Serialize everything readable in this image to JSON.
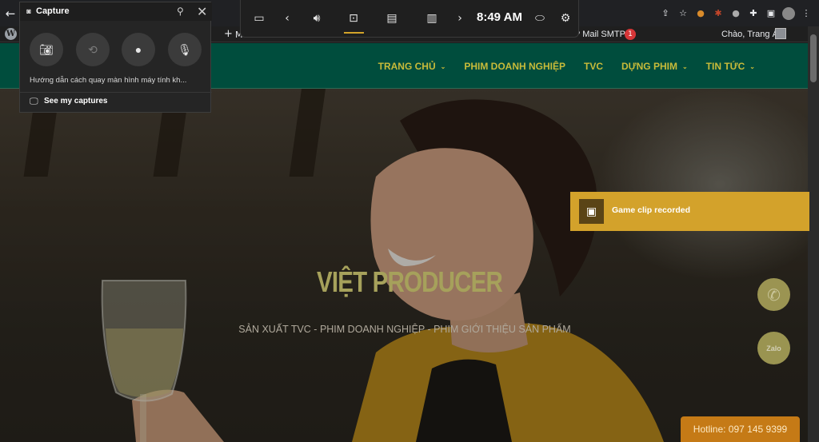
{
  "capture_widget": {
    "title": "Capture",
    "description": "Hướng dẫn cách quay màn hình máy tính kh...",
    "see_captures": "See my captures"
  },
  "gamebar": {
    "time": "8:49 AM"
  },
  "wp_admin_bar": {
    "new_short": "M",
    "smtp_label": "P Mail SMTP",
    "smtp_count": "1",
    "greeting": "Chào, Trang Ái"
  },
  "site_nav": {
    "items": [
      "TRANG CHỦ",
      "PHIM DOANH NGHIỆP",
      "TVC",
      "DỰNG PHIM",
      "TIN TỨC"
    ]
  },
  "hero": {
    "title": "VIỆT PRODUCER",
    "subtitle": "SẢN XUẤT TVC - PHIM DOANH NGHIỆP - PHIM GIỚI THIỆU SẢN PHẨM"
  },
  "floating": {
    "zalo_label": "Zalo",
    "hotline": "Hotline: 097 145 9399"
  },
  "toast": {
    "message": "Game clip recorded"
  },
  "colors": {
    "header_bg": "#004d3d",
    "nav_text": "#c8bb3a",
    "toast_bg": "#d3a22b",
    "hotline_bg": "#c57a16",
    "accent_line": "#d2a32a"
  },
  "icons": [
    "back-arrow-icon",
    "share-icon",
    "star-icon",
    "extension-icon",
    "wordpress-icon",
    "camera-icon",
    "record-last-icon",
    "record-icon",
    "mic-off-icon",
    "pin-icon",
    "close-icon",
    "widget-menu-icon",
    "chevron-left-icon",
    "audio-icon",
    "capture-icon",
    "performance-icon",
    "resources-icon",
    "chevron-right-icon",
    "mouse-icon",
    "settings-icon",
    "phone-icon",
    "gamebar-clip-icon"
  ]
}
